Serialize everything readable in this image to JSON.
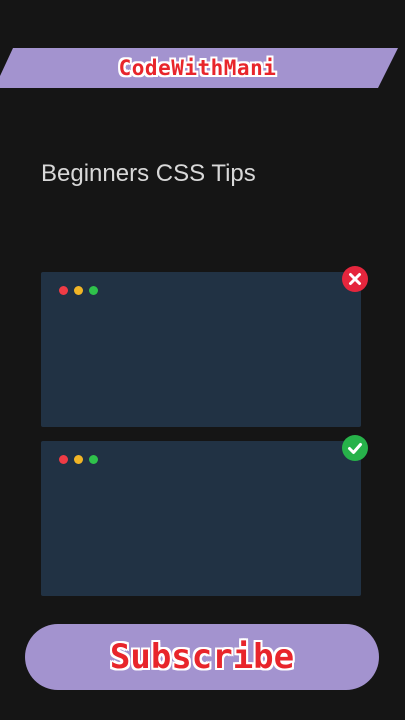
{
  "banner": {
    "label": "CodeWithMani"
  },
  "heading": {
    "text": "Beginners CSS Tips"
  },
  "windows": [
    {
      "status_icon": "x-icon",
      "status_color": "#e5263d"
    },
    {
      "status_icon": "check-icon",
      "status_color": "#27b24a"
    }
  ],
  "window_dot_colors": [
    "#ef3b45",
    "#f1b526",
    "#2fc24b"
  ],
  "subscribe": {
    "label": "Subscribe"
  },
  "colors": {
    "background": "#151515",
    "accent": "#a393cf",
    "title_red": "#e8252b",
    "window": "#213244"
  }
}
